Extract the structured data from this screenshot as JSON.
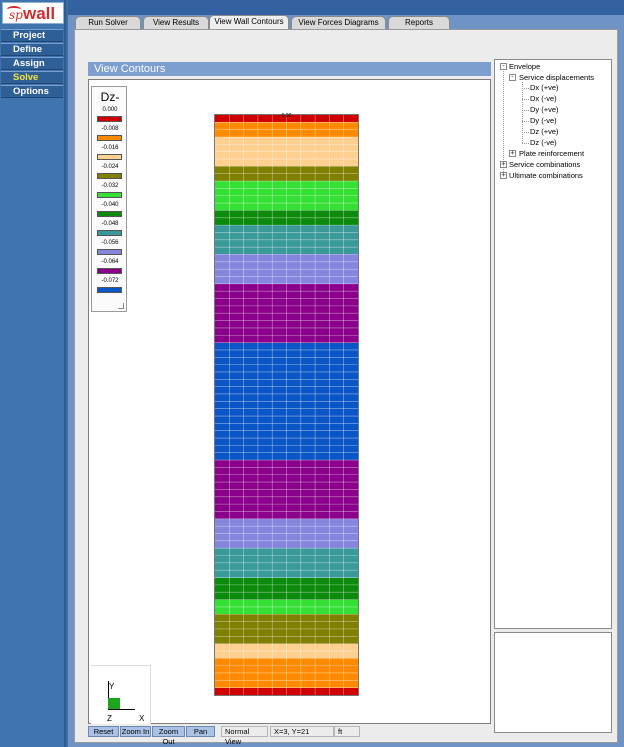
{
  "app": {
    "logo_prefix": "sp",
    "logo_main": "wall",
    "logo_color": "#d12b2b"
  },
  "menu": [
    {
      "label": "Project",
      "active": false
    },
    {
      "label": "Define",
      "active": false
    },
    {
      "label": "Assign",
      "active": false
    },
    {
      "label": "Solve",
      "active": true
    },
    {
      "label": "Options",
      "active": false
    }
  ],
  "tabs": [
    {
      "label": "Run Solver",
      "active": false
    },
    {
      "label": "View Results",
      "active": false
    },
    {
      "label": "View Wall Contours",
      "active": true
    },
    {
      "label": "View Forces Diagrams",
      "active": false
    },
    {
      "label": "Reports",
      "active": false
    }
  ],
  "view": {
    "title": "View Contours",
    "top_cell_label": "0.00"
  },
  "legend": {
    "title": "Dz-",
    "items": [
      {
        "value": "0.000",
        "color": "#d00000"
      },
      {
        "value": "-0.008",
        "color": "#ff8a00"
      },
      {
        "value": "-0.016",
        "color": "#ffd090"
      },
      {
        "value": "-0.024",
        "color": "#7f7f00"
      },
      {
        "value": "-0.032",
        "color": "#33e033"
      },
      {
        "value": "-0.040",
        "color": "#0c8a0c"
      },
      {
        "value": "-0.048",
        "color": "#3a9a9a"
      },
      {
        "value": "-0.056",
        "color": "#8585dd"
      },
      {
        "value": "-0.064",
        "color": "#8a008a"
      },
      {
        "value": "-0.072",
        "color": "#0b56c6"
      }
    ]
  },
  "contour": {
    "columns": 10,
    "bands": [
      {
        "rows": 1,
        "color": "#d00000"
      },
      {
        "rows": 2,
        "color": "#ff8a00"
      },
      {
        "rows": 4,
        "color": "#ffd090"
      },
      {
        "rows": 2,
        "color": "#7f7f00"
      },
      {
        "rows": 4,
        "color": "#33e033"
      },
      {
        "rows": 2,
        "color": "#0c8a0c"
      },
      {
        "rows": 4,
        "color": "#3a9a9a"
      },
      {
        "rows": 4,
        "color": "#8585dd"
      },
      {
        "rows": 8,
        "color": "#8a008a"
      },
      {
        "rows": 16,
        "color": "#0b56c6"
      },
      {
        "rows": 8,
        "color": "#8a008a"
      },
      {
        "rows": 4,
        "color": "#8585dd"
      },
      {
        "rows": 4,
        "color": "#3a9a9a"
      },
      {
        "rows": 3,
        "color": "#0c8a0c"
      },
      {
        "rows": 2,
        "color": "#33e033"
      },
      {
        "rows": 4,
        "color": "#7f7f00"
      },
      {
        "rows": 2,
        "color": "#ffd090"
      },
      {
        "rows": 4,
        "color": "#ff8a00"
      },
      {
        "rows": 1,
        "color": "#d00000"
      }
    ]
  },
  "axis": {
    "y_label": "Y",
    "z_label": "Z",
    "x_label": "X"
  },
  "toolbar": {
    "reset": "Reset",
    "zoom_in": "Zoom In",
    "zoom_out": "Zoom Out",
    "pan": "Pan",
    "view_mode": "Normal View",
    "coords": "X=3, Y=21",
    "units": "ft"
  },
  "tree": {
    "envelope": "Envelope",
    "service_displacements": "Service displacements",
    "leaves": [
      "Dx (+ve)",
      "Dx (-ve)",
      "Dy (+ve)",
      "Dy (-ve)",
      "Dz (+ve)",
      "Dz (-ve)"
    ],
    "plate_reinforcement": "Plate reinforcement",
    "service_combinations": "Service combinations",
    "ultimate_combinations": "Ultimate combinations",
    "expand_symbol": "+",
    "collapse_symbol": "-"
  }
}
